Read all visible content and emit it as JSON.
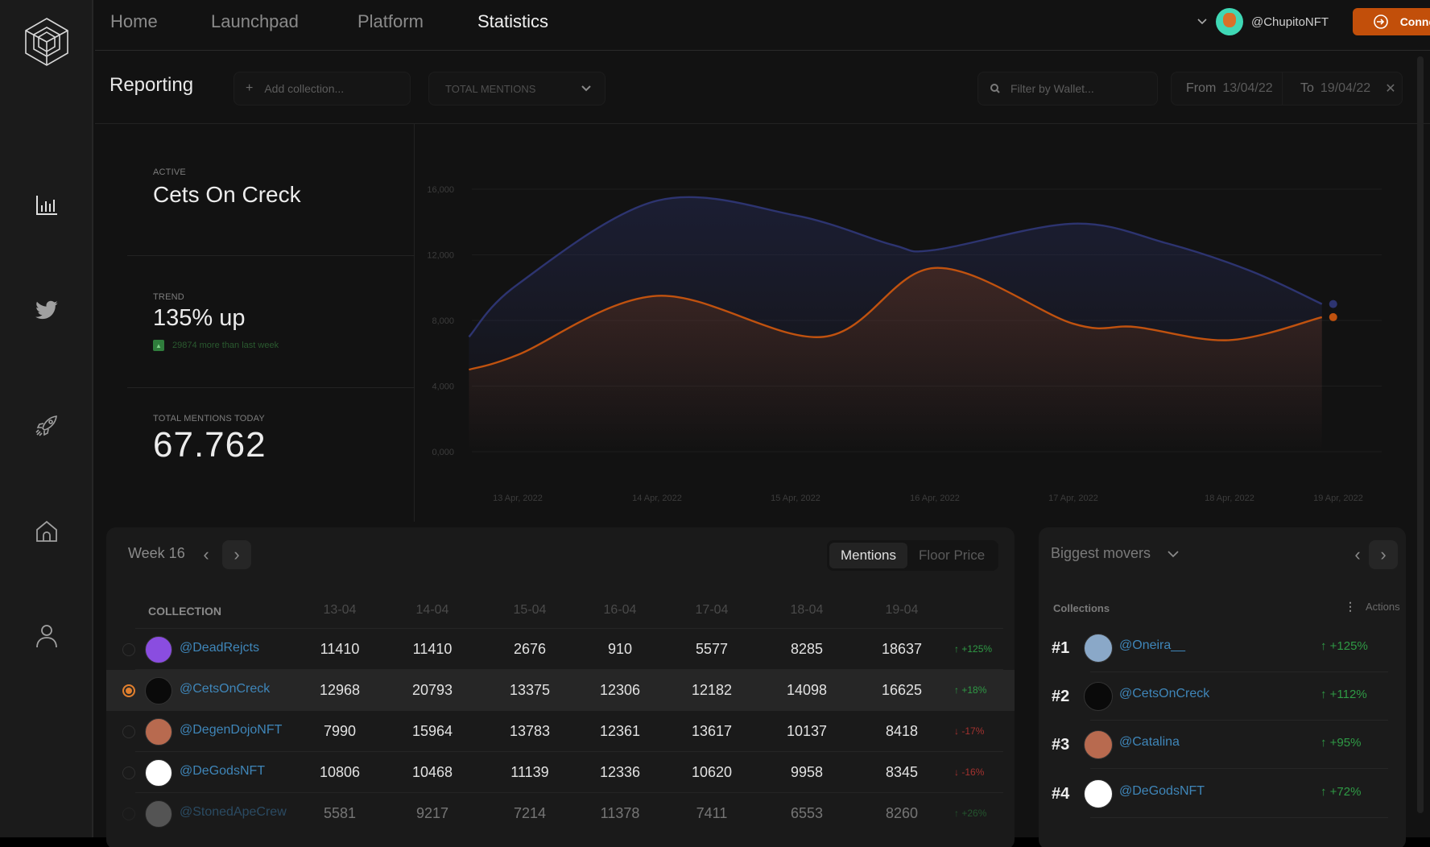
{
  "nav": {
    "items": [
      {
        "label": "Home",
        "active": false
      },
      {
        "label": "Launchpad",
        "active": false
      },
      {
        "label": "Platform",
        "active": false
      },
      {
        "label": "Statistics",
        "active": true
      }
    ],
    "user_handle": "@ChupitoNFT",
    "connect_label": "Connect Wallet"
  },
  "sidebar": {
    "icons": [
      "bar-chart-icon",
      "twitter-icon",
      "rocket-icon",
      "home-icon",
      "user-icon"
    ]
  },
  "toolbar": {
    "title": "Reporting",
    "add_collection_placeholder": "Add collection...",
    "metric_select": "TOTAL MENTIONS",
    "wallet_filter_placeholder": "Filter by Wallet...",
    "from_label": "From",
    "from_value": "13/04/22",
    "to_label": "To",
    "to_value": "19/04/22"
  },
  "stats": {
    "active_label": "ACTIVE",
    "active_value": "Cets On Creck",
    "trend_label": "TREND",
    "trend_value": "135% up",
    "trend_note": "29874 more than last week",
    "total_label": "TOTAL MENTIONS TODAY",
    "total_value": "67.762"
  },
  "colors": {
    "accent": "#c24f0a",
    "series_blue": "#2d3470",
    "series_orange": "#c0520f",
    "up": "#2f9a45",
    "down": "#a3322f",
    "link": "#3f86b9"
  },
  "chart_data": {
    "type": "line",
    "title": "",
    "xlabel": "",
    "ylabel": "",
    "x": [
      "13 Apr, 2022",
      "14 Apr, 2022",
      "15 Apr, 2022",
      "16 Apr, 2022",
      "17 Apr, 2022",
      "18 Apr, 2022",
      "19 Apr, 2022"
    ],
    "y_ticks": [
      "0,000",
      "4,000",
      "8,000",
      "12,000",
      "16,000"
    ],
    "ylim": [
      0,
      16000
    ],
    "grid": true,
    "legend": "none",
    "series": [
      {
        "name": "Blue series",
        "color": "#2d3470",
        "values": [
          7000,
          10200,
          15300,
          14400,
          12600,
          12300,
          13900,
          12700,
          11000,
          9000
        ],
        "x_positions": [
          -0.35,
          0.0,
          1.0,
          2.0,
          2.7,
          3.0,
          4.0,
          4.6,
          5.2,
          5.85
        ]
      },
      {
        "name": "Orange series",
        "color": "#c0520f",
        "values": [
          5000,
          5900,
          9500,
          7000,
          11200,
          7800,
          7600,
          6800,
          8200
        ],
        "x_positions": [
          -0.35,
          0.0,
          1.0,
          2.2,
          3.0,
          4.0,
          4.4,
          5.0,
          5.85
        ]
      }
    ]
  },
  "week_table": {
    "week_label": "Week 16",
    "tabs": [
      {
        "label": "Mentions",
        "active": true
      },
      {
        "label": "Floor Price",
        "active": false
      }
    ],
    "columns": [
      "COLLECTION",
      "13-04",
      "14-04",
      "15-04",
      "16-04",
      "17-04",
      "18-04",
      "19-04"
    ],
    "rows": [
      {
        "handle": "@DeadRejcts",
        "values": [
          "11410",
          "11410",
          "2676",
          "910",
          "5577",
          "8285",
          "18637"
        ],
        "change": "+125%",
        "dir": "up",
        "selected": false,
        "avatar": "#8a4de0"
      },
      {
        "handle": "@CetsOnCreck",
        "values": [
          "12968",
          "20793",
          "13375",
          "12306",
          "12182",
          "14098",
          "16625"
        ],
        "change": "+18%",
        "dir": "up",
        "selected": true,
        "avatar": "#0a0a0a"
      },
      {
        "handle": "@DegenDojoNFT",
        "values": [
          "7990",
          "15964",
          "13783",
          "12361",
          "13617",
          "10137",
          "8418"
        ],
        "change": "-17%",
        "dir": "down",
        "selected": false,
        "avatar": "#b86a4f"
      },
      {
        "handle": "@DeGodsNFT",
        "values": [
          "10806",
          "10468",
          "11139",
          "12336",
          "10620",
          "9958",
          "8345"
        ],
        "change": "-16%",
        "dir": "down",
        "selected": false,
        "avatar": "#ffffff"
      },
      {
        "handle": "@StonedApeCrew",
        "values": [
          "5581",
          "9217",
          "7214",
          "11378",
          "7411",
          "6553",
          "8260"
        ],
        "change": "+26%",
        "dir": "up",
        "selected": false,
        "avatar": "#9a9a9a"
      }
    ]
  },
  "movers": {
    "title": "Biggest movers",
    "col_label": "Collections",
    "actions_label": "Actions",
    "items": [
      {
        "rank": "#1",
        "handle": "@Oneira__",
        "change": "+125%",
        "avatar": "#8aa8c8"
      },
      {
        "rank": "#2",
        "handle": "@CetsOnCreck",
        "change": "+112%",
        "avatar": "#0a0a0a"
      },
      {
        "rank": "#3",
        "handle": "@Catalina",
        "change": "+95%",
        "avatar": "#b86a4f"
      },
      {
        "rank": "#4",
        "handle": "@DeGodsNFT",
        "change": "+72%",
        "avatar": "#ffffff"
      }
    ]
  }
}
